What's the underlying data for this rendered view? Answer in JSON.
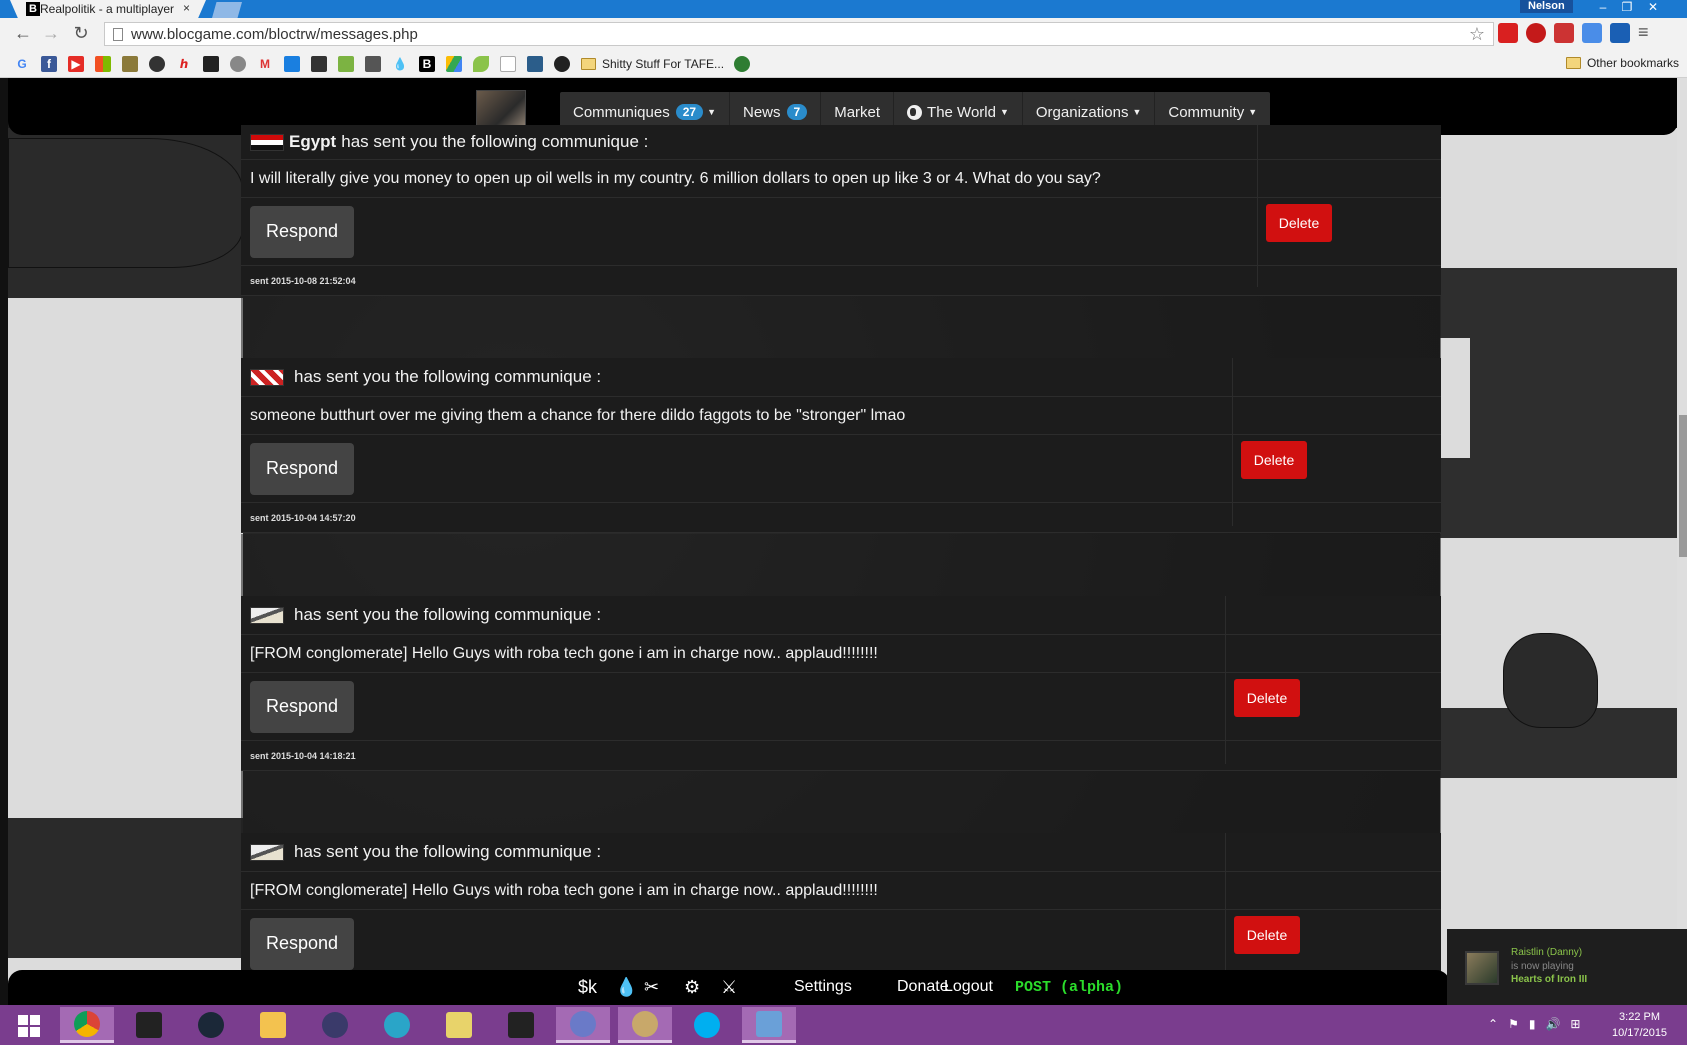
{
  "browser": {
    "tab_title": "Realpolitik - a multiplayer",
    "tab_favicon": "B",
    "tab_close": "×",
    "profile_name": "Nelson",
    "url": "www.blocgame.com/bloctrw/messages.php",
    "bookmark_folder": "Shitty Stuff For TAFE...",
    "other_bookmarks": "Other bookmarks",
    "bookmark_icons": [
      "google-icon",
      "facebook-icon",
      "youtube-icon",
      "microsoft-icon",
      "shield-icon",
      "gear-icon",
      "hpstar-icon",
      "crossed-icon",
      "reddit-icon",
      "gmail-icon",
      "dropbox-icon",
      "cube-icon",
      "android-icon",
      "calc-icon",
      "drop-icon",
      "b-icon",
      "drive-icon",
      "leaf-icon",
      "page-icon",
      "cup-icon",
      "github-icon"
    ]
  },
  "nav": {
    "communiques_label": "Communiques",
    "communiques_count": "27",
    "news_label": "News",
    "news_count": "7",
    "market_label": "Market",
    "world_label": "The World",
    "organizations_label": "Organizations",
    "community_label": "Community"
  },
  "messages": [
    {
      "sender": "Egypt",
      "header_text": "has sent you the following communique :",
      "body": "I will literally give you money to open up oil wells in my country. 6 million dollars to open up like 3 or 4. What do you say?",
      "respond_label": "Respond",
      "delete_label": "Delete",
      "sent": "sent 2015-10-08 21:52:04"
    },
    {
      "sender": "",
      "header_text": "has sent you the following communique :",
      "body": "someone butthurt over me giving them a chance for there dildo faggots to be \"stronger\" lmao",
      "respond_label": "Respond",
      "delete_label": "Delete",
      "sent": "sent 2015-10-04 14:57:20"
    },
    {
      "sender": "",
      "header_text": "has sent you the following communique :",
      "body": "[FROM conglomerate] Hello Guys with roba tech gone i am in charge now.. applaud!!!!!!!!",
      "respond_label": "Respond",
      "delete_label": "Delete",
      "sent": "sent 2015-10-04 14:18:21"
    },
    {
      "sender": "",
      "header_text": "has sent you the following communique :",
      "body": "[FROM conglomerate] Hello Guys with roba tech gone i am in charge now.. applaud!!!!!!!!",
      "respond_label": "Respond",
      "delete_label": "Delete"
    }
  ],
  "footer": {
    "money": "$k",
    "settings_label": "Settings",
    "donate_label": "Donate",
    "logout_label": "Logout",
    "post_label": "POST (alpha)"
  },
  "steam_toast": {
    "name": "Raistlin (Danny)",
    "status": "is now playing",
    "game": "Hearts of Iron III"
  },
  "taskbar": {
    "time": "3:22 PM",
    "date": "10/17/2015"
  },
  "colors": {
    "accent_blue": "#2a8ccb",
    "delete_red": "#d11010",
    "post_green": "#2bdc2b",
    "taskbar_purple": "#7a3d8e"
  }
}
